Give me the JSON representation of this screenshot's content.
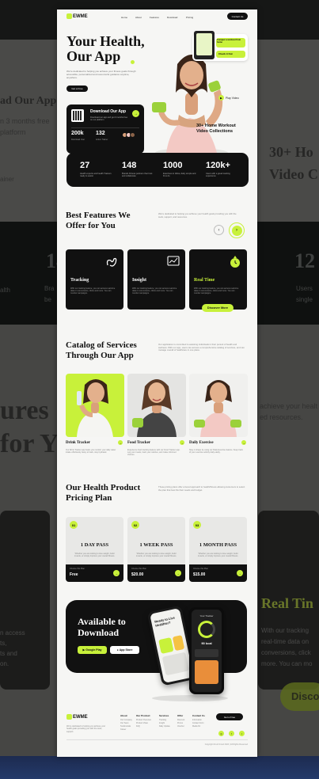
{
  "background_ghost": {
    "left_heading": "ad Our App",
    "left_sub1": "n 3 months free",
    "left_sub2": "platform",
    "left_trainer": "ainer",
    "right_heading1": "30+ Ho",
    "right_heading2": "Video C",
    "band_num1": "14",
    "band_num2": "12",
    "band_left_a": "alth",
    "band_left_b": "Bra",
    "band_left_c": "be",
    "band_right_a": "Users",
    "band_right_b": "single",
    "features_big1": "ures",
    "features_big2": "for Y",
    "right_text1": "achieve your healt",
    "right_text2": "ed resources.",
    "realtime": "Real Tin",
    "rt_desc1": "With our tracking",
    "rt_desc2": "real-time data on",
    "rt_desc3": "conversions, click",
    "rt_desc4": "more. You can mo",
    "discover": "Disco",
    "left_desc1": "n access",
    "left_desc2": "ts,",
    "left_desc3": "ts and",
    "left_desc4": "on."
  },
  "nav": {
    "logo": "EWME",
    "links": [
      "Home",
      "About",
      "Features",
      "Download",
      "Pricing"
    ],
    "contact": "Contact Us"
  },
  "hero": {
    "title": "Your Health, Our App",
    "description": "We're dedicated to helping you achieve your fitness goals through accessible, personalized and resourceful guidance anytime, anywhere.",
    "cta": "Get a Free",
    "download_card": {
      "title": "Download Our App",
      "subtitle": "Download our app and get 3 months free on our platform",
      "stats": [
        {
          "value": "200k",
          "label": "Download User"
        },
        {
          "value": "132",
          "label": "Active Trainer"
        }
      ]
    },
    "promo_card": {
      "title": "Conquer a workout from home",
      "cta": "Check it Out"
    },
    "play_label": "Play Video",
    "workout_caption": "30+ Home Workout Video Collections"
  },
  "stats": [
    {
      "value": "27",
      "label": "Health experts and health Trainers ready to assist"
    },
    {
      "value": "148",
      "label": "Brands Fitness partners that trust and collaborate"
    },
    {
      "value": "1000",
      "label": "Exercises to follow, daily simple and fit to do"
    },
    {
      "value": "120k+",
      "label": "Users with a great tracking experience"
    }
  ],
  "features": {
    "title": "Best Features We Offer for You",
    "description": "We're dedicated to helping you achieve your health goals providing you with the tools, support, and resources.",
    "cards": [
      {
        "title": "Tracking",
        "desc": "With our tracking feature, you can access real-time data on conversions, clicks and more. You can monitor campaigns."
      },
      {
        "title": "Insight",
        "desc": "With our tracking feature, you can access real-time data on conversions, clicks and more. You can monitor campaigns."
      },
      {
        "title": "Real Time",
        "desc": "With our tracking feature, you can access real-time data on conversions, clicks and more. You can monitor campaigns.",
        "cta": "Discover More"
      }
    ]
  },
  "services": {
    "title": "Catalog of Services Through Our App",
    "description": "Our application is committed to assisting individuals in their pursuit of health and wellness. With our app, users can access a comprehensive catalog of services, and can manage overall of healthcare in one place.",
    "items": [
      {
        "title": "Drink Tracker",
        "desc": "Our Drink Tracker app helps you monitor your daily water intake effortlessly. Easy to track, stay hydrated."
      },
      {
        "title": "Food Tracker",
        "desc": "Experience food tracking feature with our Food Tracker app. Log your meals, track your calories, and make informed choices."
      },
      {
        "title": "Daily Exercise",
        "desc": "Stay in shape by using our Daily Exercise feature. Keep track of your exercise activity daily easily."
      }
    ]
  },
  "pricing": {
    "title": "Our Health Product Pricing Plan",
    "description": "These pricing plans offer a tiered approach to health/fitness allowing customers to select the plan that best fits their needs and budget.",
    "plans": [
      {
        "num": "01",
        "name": "1 DAY PASS",
        "desc": "Whether you are looking to lose weight, build muscle, or simply improve your overall fitness.",
        "label": "Choose this Plan",
        "price": "Free"
      },
      {
        "num": "02",
        "name": "1 WEEK PASS",
        "desc": "Whether you are looking to lose weight, build muscle, or simply improve your overall fitness.",
        "label": "Choose this Plan",
        "price": "$20.00"
      },
      {
        "num": "03",
        "name": "1 MONTH PASS",
        "desc": "Whether you are looking to lose weight, build muscle, or simply improve your overall fitness.",
        "label": "Choose this Plan",
        "price": "$15.00"
      }
    ]
  },
  "download": {
    "title": "Available to Download",
    "google_play": "Google Play",
    "app_store": "App Store",
    "phone1_text": "Ready to Live Healthier?",
    "phone2_title": "Your Tracker",
    "phone2_value": "90 kcal"
  },
  "footer": {
    "logo": "EWME",
    "desc": "We're dedicated to helping you achieve your health goals providing you with the tools, support.",
    "columns": [
      {
        "heading": "About",
        "items": [
          "Our Company",
          "Our Team",
          "Testimonials",
          "Career"
        ]
      },
      {
        "heading": "Our Product",
        "items": [
          "Product Overview",
          "Product Video",
          "FAQ"
        ]
      },
      {
        "heading": "Services",
        "items": [
          "Tracking",
          "Insight",
          "Daily Update"
        ]
      },
      {
        "heading": "Offer",
        "items": [
          "Discount",
          "Promo",
          "Voucher"
        ]
      },
      {
        "heading": "Contact Us",
        "items": [
          "Information",
          "Contact Form",
          "Media Kit"
        ]
      }
    ],
    "cta": "Get a Free",
    "copyright": "Copyright Fresh Food 2024 | All Rights Reserved"
  },
  "colors": {
    "accent": "#c8f13a",
    "dark": "#111111",
    "page": "#f6f6f4"
  }
}
